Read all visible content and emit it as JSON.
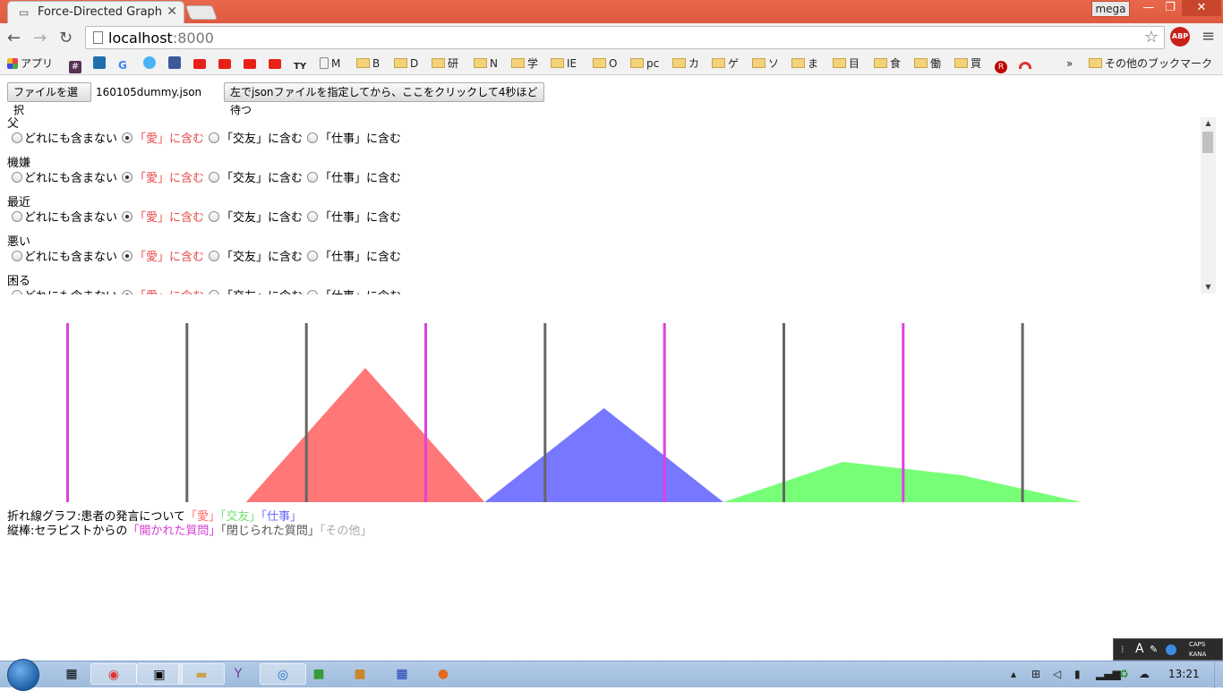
{
  "browser": {
    "tab_title": "Force-Directed Graph",
    "tab_close": "✕",
    "profile_name": "mega",
    "win_min": "—",
    "win_max": "❐",
    "win_close": "✕",
    "url_host": "localhost",
    "url_port": ":8000",
    "abp_label": "ABP",
    "icons": {
      "back": "arrow-left-icon",
      "forward": "arrow-right-icon",
      "reload": "reload-icon",
      "star": "star-icon",
      "menu": "hamburger-menu-icon"
    }
  },
  "bookmarks": {
    "apps": "アプリ",
    "items": [
      "",
      "",
      "",
      "",
      "",
      "",
      "",
      "",
      "",
      "",
      "TY",
      "M",
      "B",
      "D",
      "研",
      "N",
      "学",
      "IE",
      "O",
      "pc",
      "カ",
      "ゲ",
      "ソ",
      "ま",
      "目",
      "食",
      "働",
      "買",
      "",
      ""
    ],
    "overflow": "»",
    "other": "その他のブックマーク"
  },
  "controls": {
    "file_button": "ファイルを選択",
    "file_name": "160105dummy.json",
    "run_button": "左でjsonファイルを指定してから、ここをクリックして4秒ほど待つ"
  },
  "words": [
    {
      "word": "父",
      "selected": "愛"
    },
    {
      "word": "機嫌",
      "selected": "愛"
    },
    {
      "word": "最近",
      "selected": "愛"
    },
    {
      "word": "悪い",
      "selected": "愛"
    },
    {
      "word": "困る",
      "selected": "愛"
    }
  ],
  "options": {
    "none": "どれにも含まない",
    "love": "「愛」に含む",
    "friend": "「交友」に含む",
    "work": "「仕事」に含む"
  },
  "chart_data": {
    "type": "area",
    "description_visible": false,
    "x": [
      0,
      1,
      2,
      3,
      4,
      5,
      6,
      7,
      8,
      9
    ],
    "series": [
      {
        "name": "愛",
        "color": "#ff7777",
        "values": [
          0,
          0,
          0,
          1.0,
          0,
          0.1,
          0,
          0,
          0,
          0
        ]
      },
      {
        "name": "交友",
        "color": "#7777ff",
        "values": [
          0,
          0,
          0,
          0,
          0,
          0.7,
          0,
          0,
          0,
          0
        ]
      },
      {
        "name": "仕事",
        "color": "#77ff77",
        "values": [
          0,
          0,
          0,
          0,
          0,
          0,
          0,
          0.3,
          0.2,
          0
        ]
      }
    ],
    "bars": [
      {
        "type": "開かれた質問",
        "color": "#e040e0"
      },
      {
        "type": "閉じられた質問",
        "color": "#666666"
      },
      {
        "type": "閉じられた質問",
        "color": "#666666"
      },
      {
        "type": "開かれた質問",
        "color": "#e040e0"
      },
      {
        "type": "閉じられた質問",
        "color": "#666666"
      },
      {
        "type": "開かれた質問",
        "color": "#e040e0"
      },
      {
        "type": "閉じられた質問",
        "color": "#666666"
      },
      {
        "type": "開かれた質問",
        "color": "#e040e0"
      },
      {
        "type": "閉じられた質問",
        "color": "#666666"
      }
    ]
  },
  "legend": {
    "line1_prefix": "折れ線グラフ:患者の発言について",
    "line1_love": "「愛」",
    "line1_friend": "「交友」",
    "line1_work": "「仕事」",
    "line2_prefix": "縦棒:セラピストからの",
    "line2_open": "「開かれた質問」",
    "line2_closed": "「閉じられた質問」",
    "line2_other": "「その他」",
    "colors": {
      "love": "#ff6a6a",
      "friend": "#6ee06e",
      "work": "#6a6aff",
      "open": "#d43ad4",
      "closed": "#555555",
      "other": "#aaaaaa"
    }
  },
  "taskbar": {
    "clock": "13:21",
    "ime_a": "A",
    "ime_caps": "CAPS",
    "ime_kana": "KANA"
  }
}
